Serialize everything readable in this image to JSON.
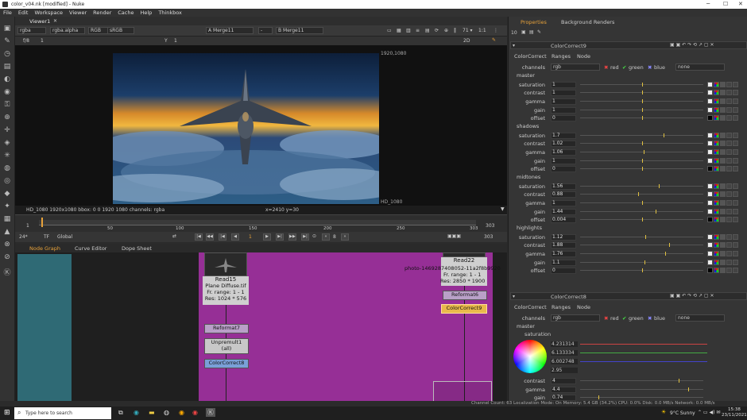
{
  "window": {
    "title": "color_v04.nk [modified] - Nuke"
  },
  "menu": [
    "File",
    "Edit",
    "Workspace",
    "Viewer",
    "Render",
    "Cache",
    "Help",
    "Thinkbox"
  ],
  "viewer": {
    "tab": "Viewer1",
    "channels": "rgba",
    "alpha": "rgba.alpha",
    "colorspace": "RGB",
    "lut": "sRGB",
    "a_input": "A  Merge11",
    "b_input": "B  Merge11",
    "zoom": "71 ▾",
    "ratio": "1:1",
    "mode": "2D",
    "fstop": "f/8",
    "frame_field": "1",
    "y_label": "Y",
    "y_val": "1",
    "format_label": "1920,1080",
    "format_corner": "HD_1080",
    "info": "HD_1080 1920x1080  bbox: 0 0 1920 1080 channels: rgba",
    "coords": "x=2410 y=30"
  },
  "timeline": {
    "start": "1",
    "end": "303",
    "ticks": [
      "50",
      "100",
      "150",
      "200",
      "250",
      "303"
    ],
    "current": "1"
  },
  "playback": {
    "fps": "24*",
    "tf": "TF",
    "global": "Global",
    "frame": "1",
    "step": "8",
    "end_frame": "303"
  },
  "graph": {
    "tabs": [
      "Node Graph",
      "Curve Editor",
      "Dope Sheet"
    ],
    "read15": {
      "name": "Read15",
      "file": "Plane Diffuse.tif",
      "range": "Fr. range: 1 - 1",
      "res": "Res: 1024 * 576"
    },
    "read22": {
      "name": "Read22",
      "file": "photo-1469287408052-11a2f8b9920",
      "range": "Fr. range: 1 - 1",
      "res": "Res: 2850 * 1900"
    },
    "reformat7": "Reformat7",
    "unpremult": "Unpremult1",
    "unpremult_sub": "(all)",
    "cc8": "ColorCorrect8",
    "reformat6": "Reformat6",
    "cc9": "ColorCorrect9"
  },
  "props": {
    "tabs": [
      "Properties",
      "Background Renders"
    ],
    "count": "10",
    "cc9": {
      "name": "ColorCorrect9",
      "subtabs": [
        "ColorCorrect",
        "Ranges",
        "Node"
      ],
      "channels_label": "channels",
      "channels": "rgb",
      "red": "red",
      "green": "green",
      "blue": "blue",
      "none": "none",
      "sections": [
        {
          "name": "master",
          "rows": [
            [
              "saturation",
              "1"
            ],
            [
              "contrast",
              "1"
            ],
            [
              "gamma",
              "1"
            ],
            [
              "gain",
              "1"
            ],
            [
              "offset",
              "0"
            ]
          ]
        },
        {
          "name": "shadows",
          "rows": [
            [
              "saturation",
              "1.7"
            ],
            [
              "contrast",
              "1.02"
            ],
            [
              "gamma",
              "1.06"
            ],
            [
              "gain",
              "1"
            ],
            [
              "offset",
              "0"
            ]
          ]
        },
        {
          "name": "midtones",
          "rows": [
            [
              "saturation",
              "1.56"
            ],
            [
              "contrast",
              "0.88"
            ],
            [
              "gamma",
              "1"
            ],
            [
              "gain",
              "1.44"
            ],
            [
              "offset",
              "0.004"
            ]
          ]
        },
        {
          "name": "highlights",
          "rows": [
            [
              "saturation",
              "1.12"
            ],
            [
              "contrast",
              "1.88"
            ],
            [
              "gamma",
              "1.76"
            ],
            [
              "gain",
              "1.1"
            ],
            [
              "offset",
              "0"
            ]
          ]
        }
      ]
    },
    "cc8": {
      "name": "ColorCorrect8",
      "subtabs": [
        "ColorCorrect",
        "Ranges",
        "Node"
      ],
      "channels_label": "channels",
      "channels": "rgb",
      "red": "red",
      "green": "green",
      "blue": "blue",
      "none": "none",
      "section": "master",
      "sat_label": "saturation",
      "sat_vals": [
        "4.231314",
        "6.133334",
        "6.002748",
        "2.95"
      ],
      "rows": [
        [
          "contrast",
          "4"
        ],
        [
          "gamma",
          "4.4"
        ],
        [
          "gain",
          "0.74"
        ]
      ]
    }
  },
  "status": "Channel Count: 63  Localization Mode: On  Memory: 5.4 GB (34.2%)  CPU: 0.0%  Disk: 0.0 MB/s  Network: 0.0 MB/s",
  "taskbar": {
    "search": "Type here to search",
    "weather": "9°C  Sunny",
    "time": "15:38",
    "date": "23/11/2021"
  },
  "colors": {
    "accent": "#e8a23a",
    "backdrop_purple": "#962f96",
    "backdrop_teal": "#2f6a75",
    "selected_node": "#e9b94b"
  }
}
